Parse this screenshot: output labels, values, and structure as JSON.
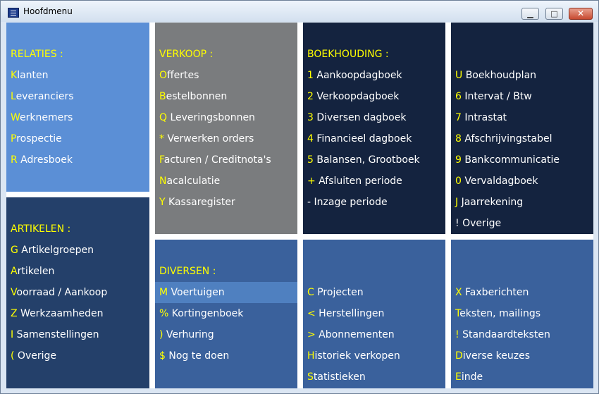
{
  "window": {
    "title": "Hoofdmenu",
    "minimize": "▁",
    "maximize": "□",
    "close": "✕"
  },
  "panels": [
    {
      "id": "relaties",
      "bg": "#5b8fd6",
      "title": "RELATIES :",
      "items": [
        {
          "k": "K",
          "t": "lanten"
        },
        {
          "k": "L",
          "t": "everanciers"
        },
        {
          "k": "W",
          "t": "erknemers"
        },
        {
          "k": "P",
          "t": "rospectie"
        },
        {
          "k": "R",
          "t": " Adresboek"
        }
      ]
    },
    {
      "id": "verkoop",
      "bg": "#7a7c7e",
      "title": "VERKOOP :",
      "items": [
        {
          "k": "O",
          "t": "ffertes"
        },
        {
          "k": "B",
          "t": "estelbonnen"
        },
        {
          "k": "Q",
          "t": " Leveringsbonnen"
        },
        {
          "k": "*",
          "t": " Verwerken orders"
        },
        {
          "k": "F",
          "t": "acturen / Creditnota's"
        },
        {
          "k": "N",
          "t": "acalculatie"
        },
        {
          "k": "Y",
          "t": " Kassaregister"
        }
      ]
    },
    {
      "id": "boekhouding",
      "bg": "#14233f",
      "title": "BOEKHOUDING :",
      "items": [
        {
          "k": "1",
          "t": " Aankoopdagboek"
        },
        {
          "k": "2",
          "t": " Verkoopdagboek"
        },
        {
          "k": "3",
          "t": " Diversen dagboek"
        },
        {
          "k": "4",
          "t": " Financieel dagboek"
        },
        {
          "k": "5",
          "t": " Balansen, Grootboek"
        },
        {
          "k": "+",
          "t": " Afsluiten periode"
        },
        {
          "k": "-",
          "t": " Inzage periode",
          "plain": true
        }
      ]
    },
    {
      "id": "boekhouding2",
      "bg": "#14233f",
      "title": "",
      "items": [
        {
          "k": "U",
          "t": " Boekhoudplan"
        },
        {
          "k": "6",
          "t": " Intervat / Btw"
        },
        {
          "k": "7",
          "t": " Intrastat"
        },
        {
          "k": "8",
          "t": " Afschrijvingstabel"
        },
        {
          "k": "9",
          "t": " Bankcommunicatie"
        },
        {
          "k": "0",
          "t": " Vervaldagboek"
        },
        {
          "k": "J",
          "t": " Jaarrekening"
        },
        {
          "k": "!",
          "t": " Overige",
          "plain": true
        }
      ]
    },
    {
      "id": "artikelen",
      "bg": "#24406a",
      "title": "ARTIKELEN :",
      "items": [
        {
          "k": "G",
          "t": " Artikelgroepen"
        },
        {
          "k": "A",
          "t": "rtikelen"
        },
        {
          "k": "V",
          "t": "oorraad / Aankoop"
        },
        {
          "k": "Z",
          "t": " Werkzaamheden"
        },
        {
          "k": "I",
          "t": " Samenstellingen"
        },
        {
          "k": "(",
          "t": " Overige"
        }
      ]
    },
    {
      "id": "diversen",
      "bg": "#3a619c",
      "title": "DIVERSEN :",
      "items": [
        {
          "k": "M",
          "t": " Voertuigen",
          "hl": true
        },
        {
          "k": "%",
          "t": " Kortingenboek"
        },
        {
          "k": ")",
          "t": " Verhuring"
        },
        {
          "k": "$",
          "t": " Nog te doen"
        }
      ]
    },
    {
      "id": "projecten",
      "bg": "#3a619c",
      "title": "",
      "items": [
        {
          "k": "C",
          "t": " Projecten"
        },
        {
          "k": "<",
          "t": " Herstellingen"
        },
        {
          "k": ">",
          "t": " Abonnementen"
        },
        {
          "k": "H",
          "t": "istoriek verkopen"
        },
        {
          "k": "S",
          "t": "tatistieken"
        }
      ]
    },
    {
      "id": "faxen",
      "bg": "#3a619c",
      "title": "",
      "items": [
        {
          "k": "X",
          "t": " Faxberichten"
        },
        {
          "k": "T",
          "t": "eksten, mailings"
        },
        {
          "k": "!",
          "t": " Standaardteksten"
        },
        {
          "k": "D",
          "t": "iverse keuzes"
        },
        {
          "k": "E",
          "t": "inde"
        }
      ]
    }
  ]
}
